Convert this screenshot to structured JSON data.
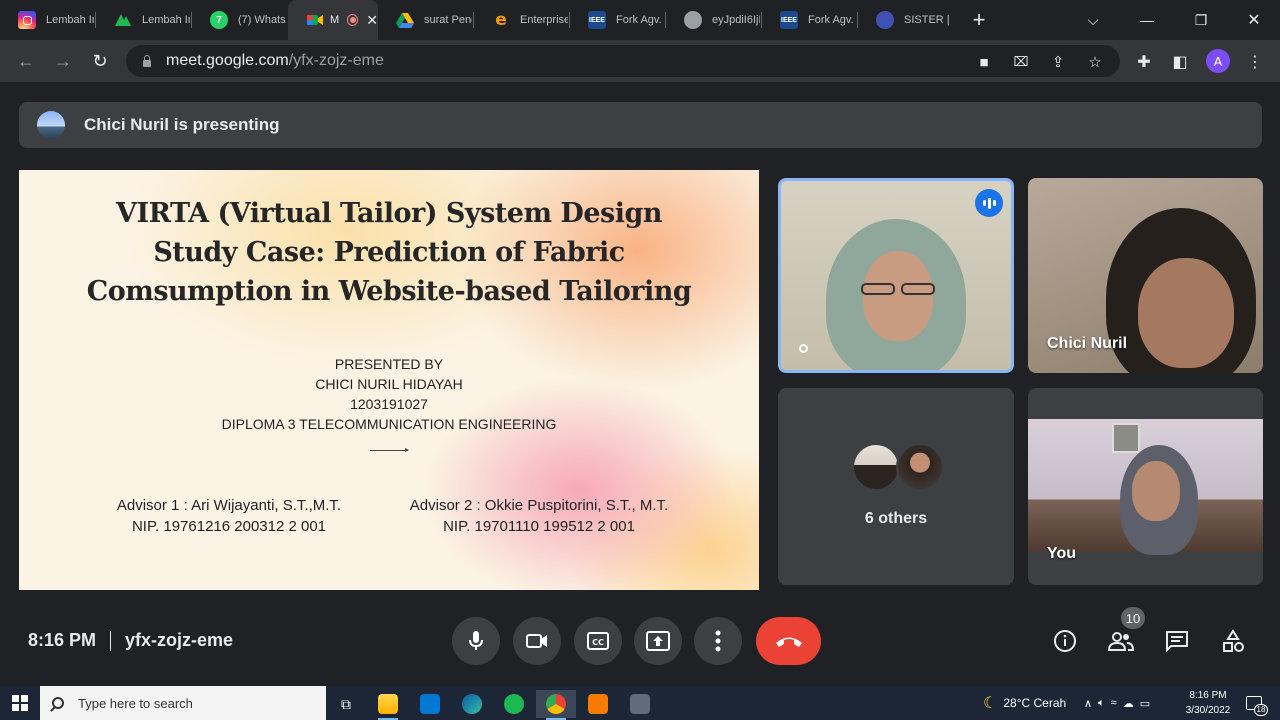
{
  "browser": {
    "tabs": [
      {
        "title": "Lembah In",
        "icon": "instagram-icon",
        "color": "#d6249f"
      },
      {
        "title": "Lembah In",
        "icon": "app-icon",
        "color": "#1db954"
      },
      {
        "title": "(7) Whats/",
        "icon": "whatsapp-icon",
        "color": "#25d366"
      },
      {
        "title": "M",
        "icon": "google-meet-icon",
        "color": "#00897b",
        "active": true
      },
      {
        "title": "surat Peng",
        "icon": "google-drive-icon",
        "color": "#fbbc04"
      },
      {
        "title": "Enterprise",
        "icon": "edge-e-icon",
        "color": "#f29900"
      },
      {
        "title": "Fork Agv.",
        "icon": "ieee-icon",
        "color": "#1a4a8b"
      },
      {
        "title": "eyJpdiI6IjR",
        "icon": "globe-icon",
        "color": "#9aa0a6"
      },
      {
        "title": "Fork Agv.",
        "icon": "ieee-icon",
        "color": "#1a4a8b"
      },
      {
        "title": "SISTER | La",
        "icon": "sister-icon",
        "color": "#3f51b5"
      }
    ],
    "url_host": "meet.google.com",
    "url_path": "/yfx-zojz-eme",
    "profile_initial": "A"
  },
  "meet": {
    "presenting_text": "Chici Nuril is presenting",
    "slide": {
      "title_lines": [
        "VIRTA (Virtual Tailor) System Design",
        "Study Case: Prediction of Fabric",
        "Comsumption in Website-based Tailoring"
      ],
      "presented_lines": [
        "PRESENTED BY",
        "CHICI NURIL HIDAYAH",
        "1203191027",
        "DIPLOMA 3 TELECOMMUNICATION ENGINEERING"
      ],
      "advisor1": {
        "name": "Advisor 1 : Ari Wijayanti, S.T.,M.T.",
        "nip": "NIP. 19761216 200312 2 001"
      },
      "advisor2": {
        "name": "Advisor 2 : Okkie Puspitorini, S.T., M.T.",
        "nip": "NIP. 19701110 199512 2 001"
      }
    },
    "tiles": {
      "speaker_name": "Chici Nuril",
      "others_label": "6 others",
      "self_label": "You"
    },
    "time": "8:16 PM",
    "meeting_code": "yfx-zojz-eme",
    "participant_count": "10",
    "hangup_color": "#ea4335"
  },
  "taskbar": {
    "search_placeholder": "Type here to search",
    "weather": "28°C  Cerah",
    "time": "8:16 PM",
    "date": "3/30/2022",
    "notification_count": "18"
  }
}
